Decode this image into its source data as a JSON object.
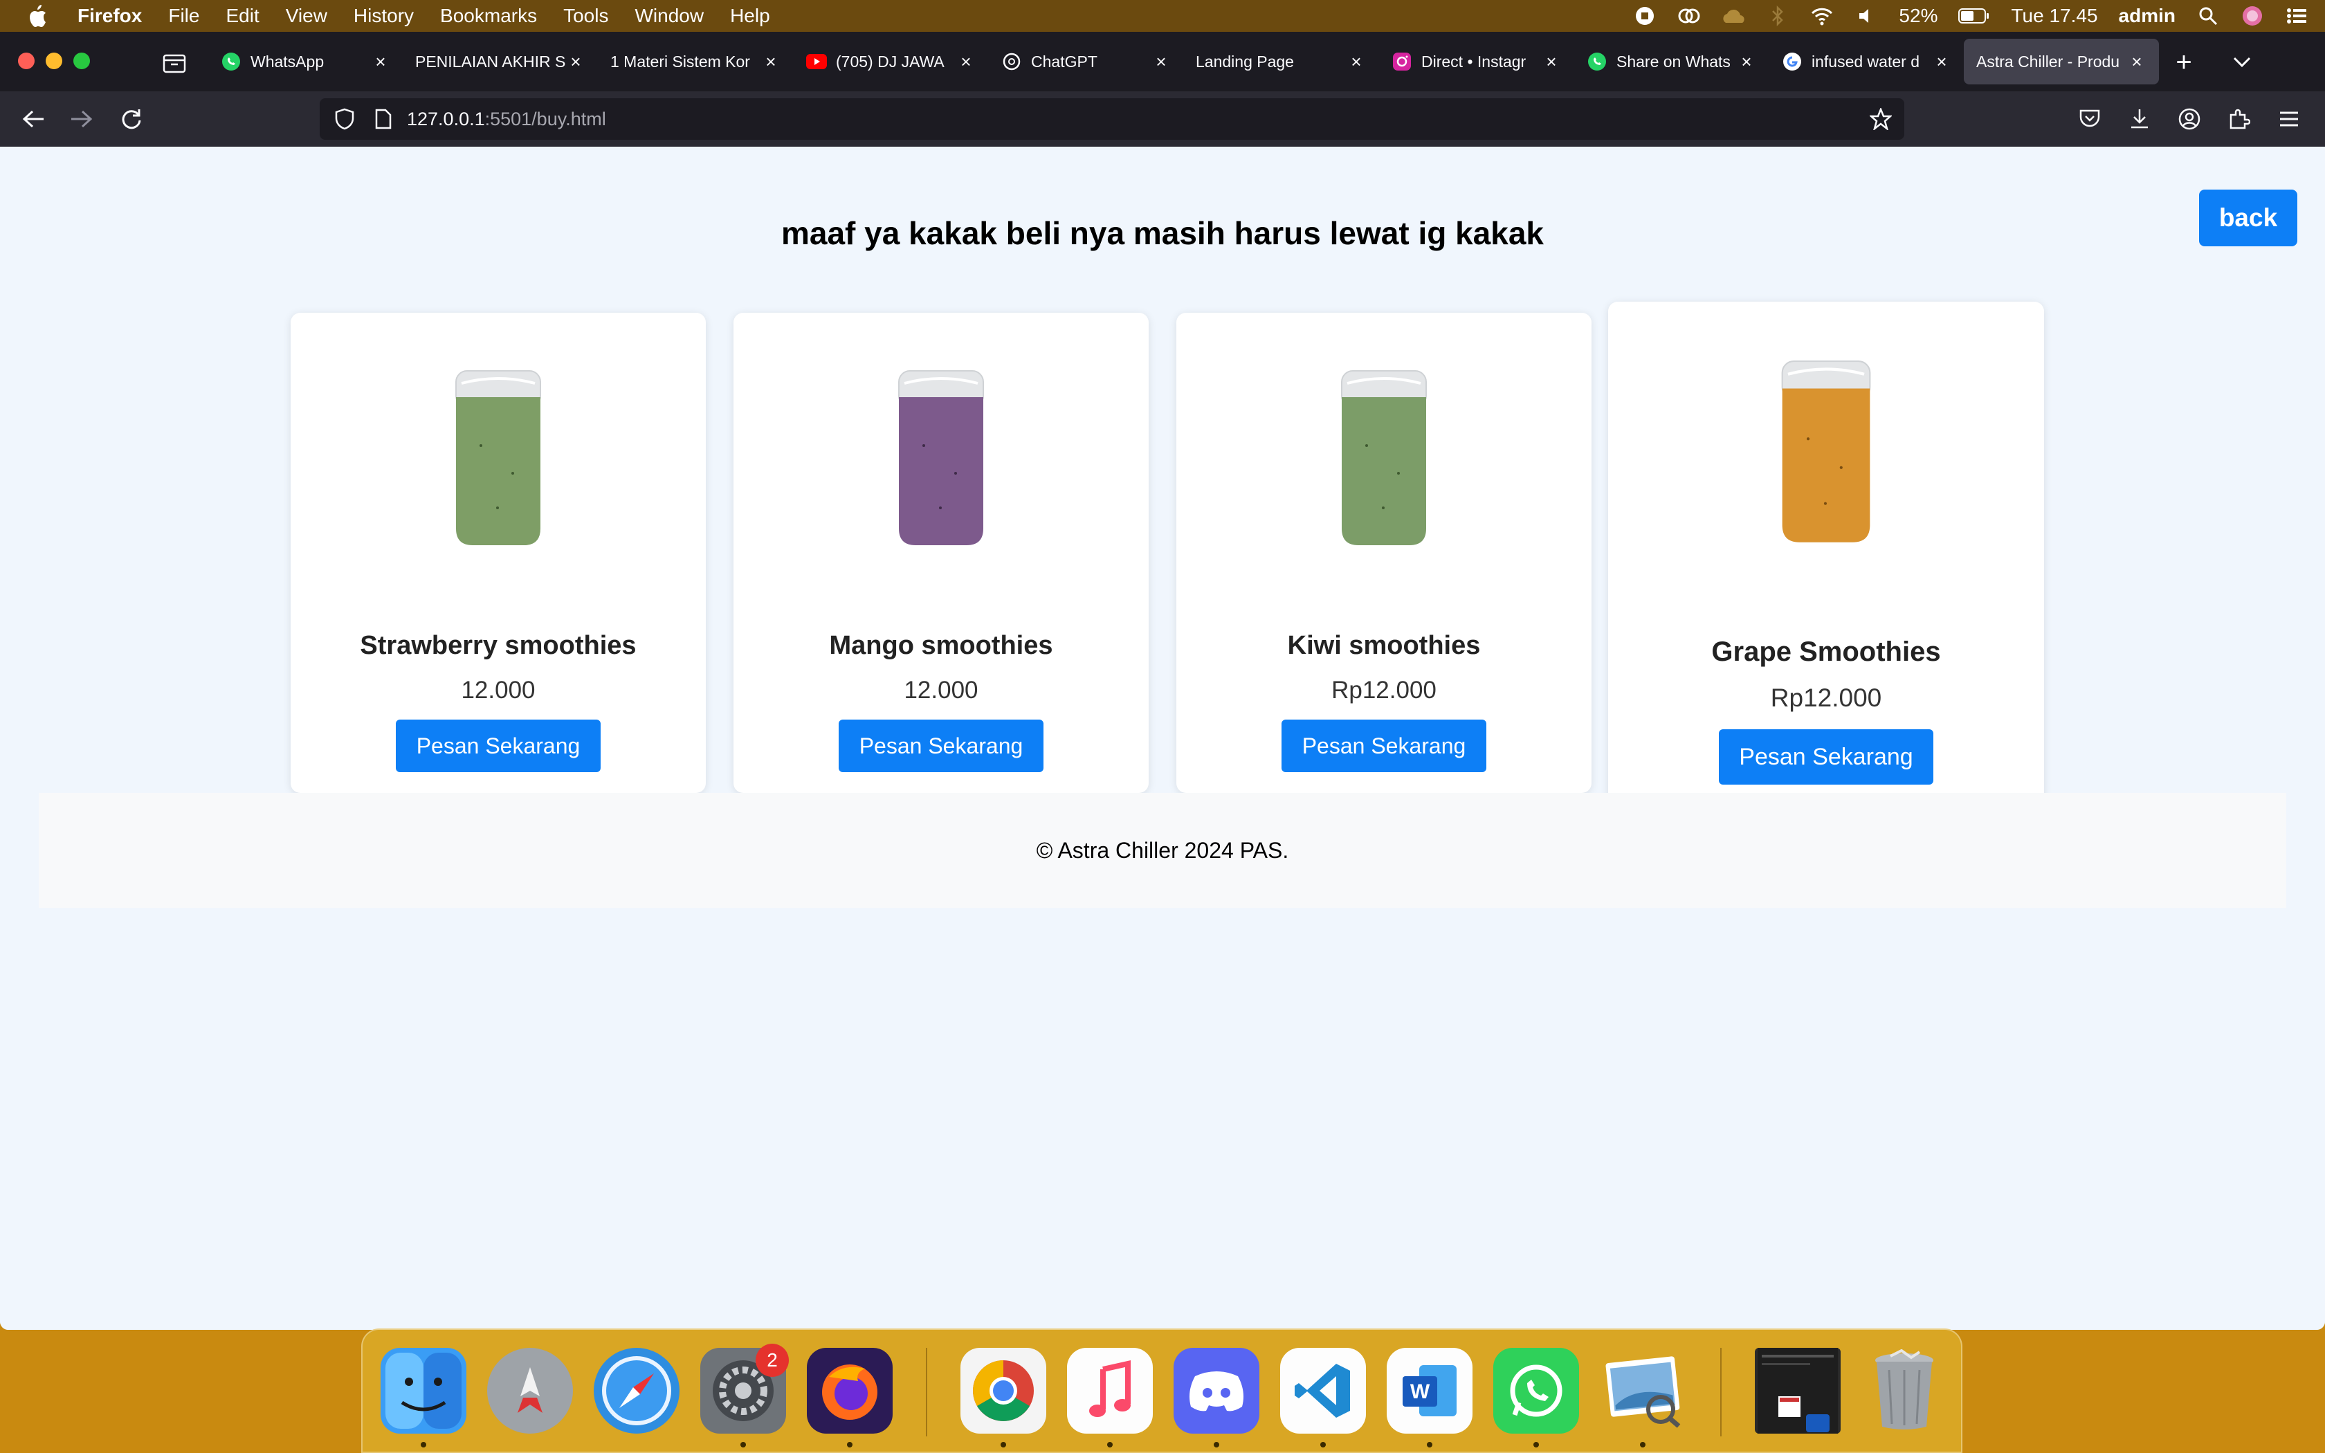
{
  "menubar": {
    "app_name": "Firefox",
    "items": [
      "File",
      "Edit",
      "View",
      "History",
      "Bookmarks",
      "Tools",
      "Window",
      "Help"
    ],
    "battery": "52%",
    "clock": "Tue 17.45",
    "user": "admin"
  },
  "tabs": [
    {
      "label": "WhatsApp",
      "icon": "whatsapp-icon"
    },
    {
      "label": "PENILAIAN AKHIR S",
      "icon": "none"
    },
    {
      "label": "1 Materi Sistem Kor",
      "icon": "none"
    },
    {
      "label": "(705) DJ JAWA",
      "icon": "youtube-icon"
    },
    {
      "label": "ChatGPT",
      "icon": "chatgpt-icon"
    },
    {
      "label": "Landing Page",
      "icon": "none"
    },
    {
      "label": "Direct • Instagr",
      "icon": "instagram-icon"
    },
    {
      "label": "Share on Whats",
      "icon": "whatsapp-icon"
    },
    {
      "label": "infused water d",
      "icon": "google-icon"
    },
    {
      "label": "Astra Chiller - Produ",
      "icon": "none",
      "active": true
    }
  ],
  "address": {
    "host": "127.0.0.1",
    "rest": ":5501/buy.html"
  },
  "page": {
    "back_label": "back",
    "heading": "maaf ya kakak beli nya masih harus lewat ig kakak",
    "footer": "© Astra Chiller 2024 PAS.",
    "products": [
      {
        "name": "Strawberry smoothies",
        "price": "12.000",
        "button": "Pesan Sekarang",
        "drink_color": "#7e9e66"
      },
      {
        "name": "Mango smoothies",
        "price": "12.000",
        "button": "Pesan Sekarang",
        "drink_color": "#7d5a8c"
      },
      {
        "name": "Kiwi smoothies",
        "price": "Rp12.000",
        "button": "Pesan Sekarang",
        "drink_color": "#7c9d68"
      },
      {
        "name": "Grape Smoothies",
        "price": "Rp12.000",
        "button": "Pesan Sekarang",
        "drink_color": "#d9932f"
      }
    ]
  },
  "dock": {
    "apps": [
      "finder-icon",
      "launchpad-icon",
      "safari-icon",
      "system-settings-icon",
      "firefox-icon",
      "chrome-icon",
      "music-icon",
      "discord-icon",
      "vscode-icon",
      "word-icon",
      "whatsapp-icon",
      "preview-icon",
      "window-thumbnail",
      "trash-icon"
    ],
    "settings_badge": "2"
  },
  "colors": {
    "accent": "#0d7ff6",
    "page_bg": "#f0f6fd"
  }
}
